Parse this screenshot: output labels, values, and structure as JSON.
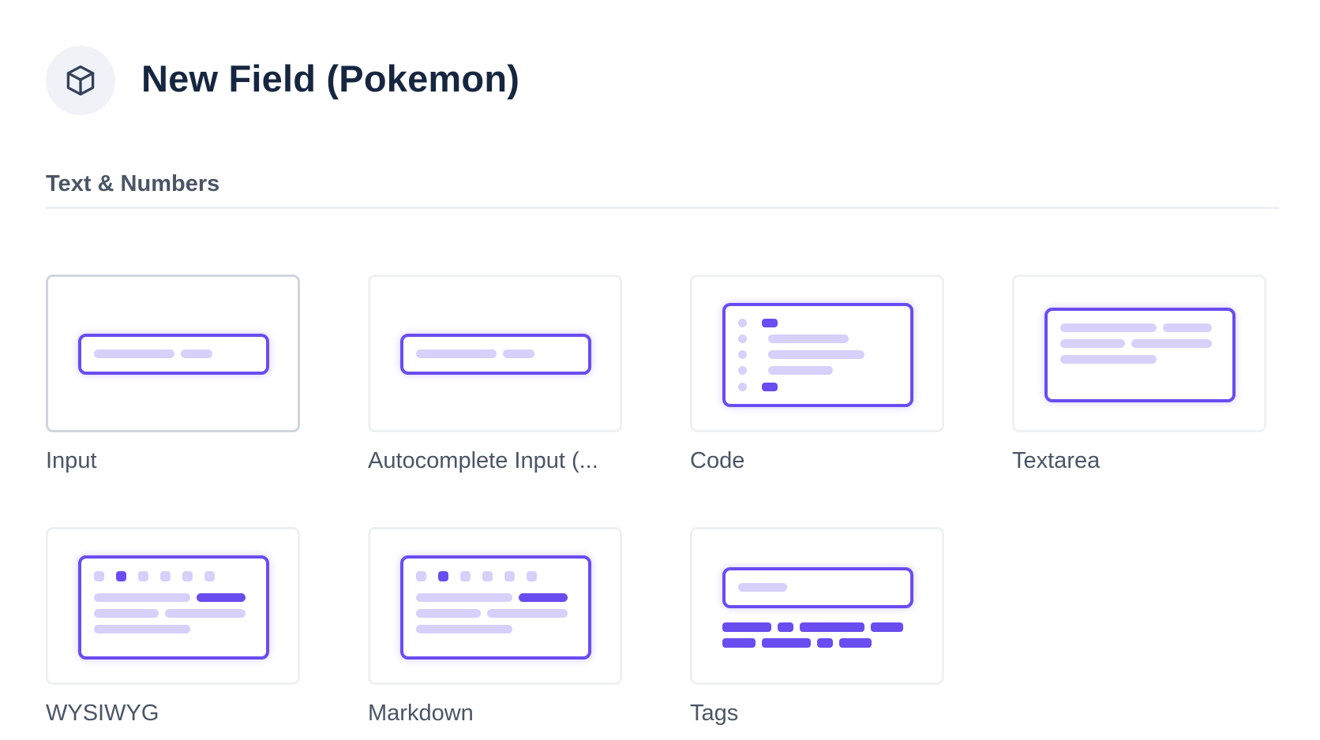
{
  "header": {
    "title": "New Field (Pokemon)",
    "icon": "cube-icon"
  },
  "section": {
    "title": "Text & Numbers"
  },
  "field_types": [
    {
      "label": "Input",
      "selected": true
    },
    {
      "label": "Autocomplete Input (...",
      "selected": false
    },
    {
      "label": "Code",
      "selected": false
    },
    {
      "label": "Textarea",
      "selected": false
    },
    {
      "label": "WYSIWYG",
      "selected": false
    },
    {
      "label": "Markdown",
      "selected": false
    },
    {
      "label": "Tags",
      "selected": false
    }
  ],
  "colors": {
    "accent": "#6a4cf0",
    "accent_light": "#d6d0fb",
    "title": "#172640",
    "muted_text": "#4a5566"
  }
}
